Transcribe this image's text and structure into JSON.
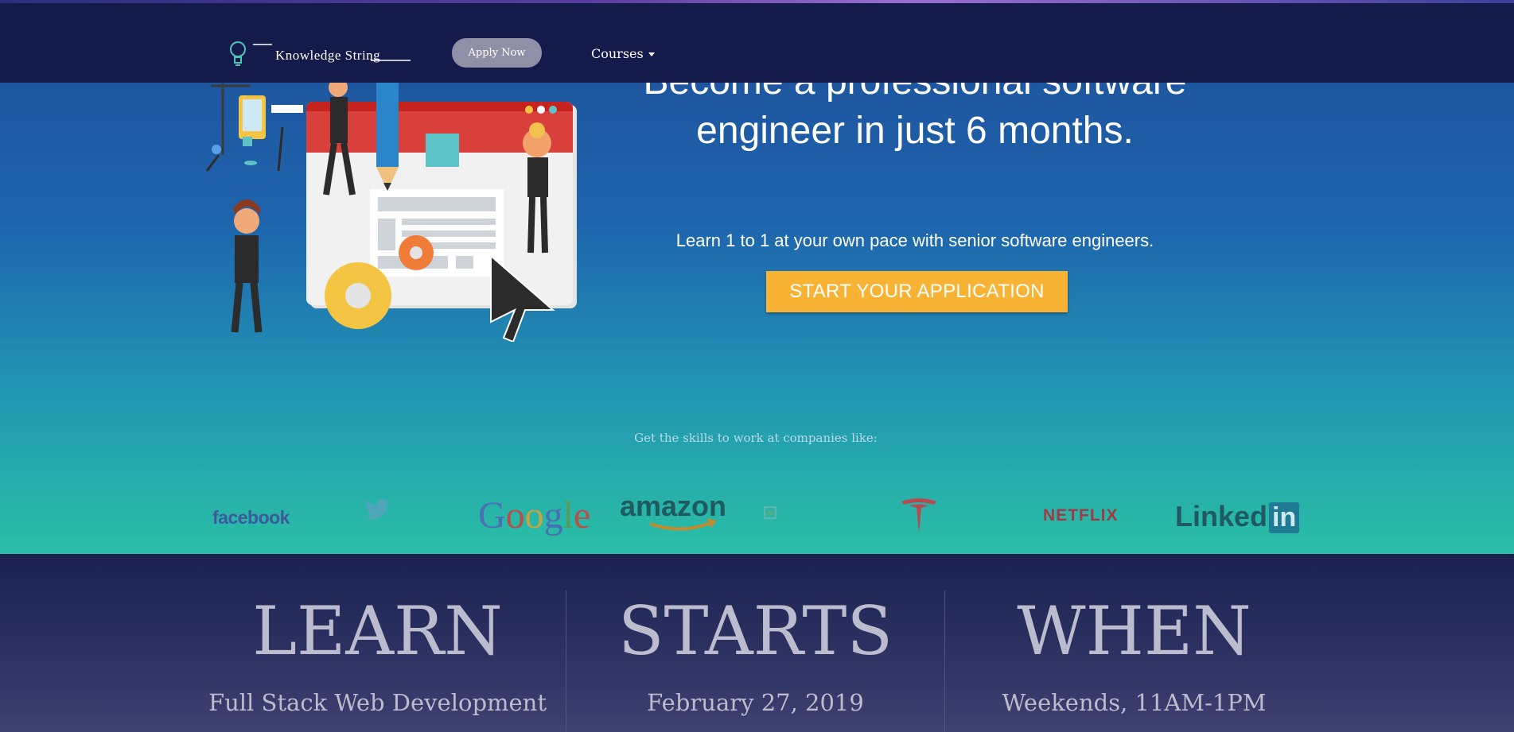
{
  "nav": {
    "logo_text": "Knowledge String",
    "apply_label": "Apply Now",
    "courses_label": "Courses"
  },
  "hero": {
    "headline_line1": "Become a professional software",
    "headline_line2": "engineer in just 6 months.",
    "subtitle": "Learn 1 to 1 at your own pace with senior software engineers.",
    "cta_label": "START YOUR APPLICATION"
  },
  "companies": {
    "heading": "Get the skills to work at companies like:",
    "logos": [
      "facebook",
      "twitter-icon",
      "Google",
      "amazon",
      "broken-image-icon",
      "tesla-icon",
      "NETFLIX",
      "LinkedIn"
    ],
    "facebook": "facebook",
    "google": "Google",
    "amazon": "amazon",
    "netflix": "NETFLIX",
    "linkedin_a": "Linked",
    "linkedin_b": "in"
  },
  "info": [
    {
      "title": "LEARN",
      "value": "Full Stack Web Development"
    },
    {
      "title": "STARTS",
      "value": "February 27, 2019"
    },
    {
      "title": "WHEN",
      "value": "Weekends, 11AM-1PM"
    }
  ],
  "colors": {
    "navbar": "#141b4a",
    "cta": "#f8b334",
    "bottom": "#1a2150"
  }
}
